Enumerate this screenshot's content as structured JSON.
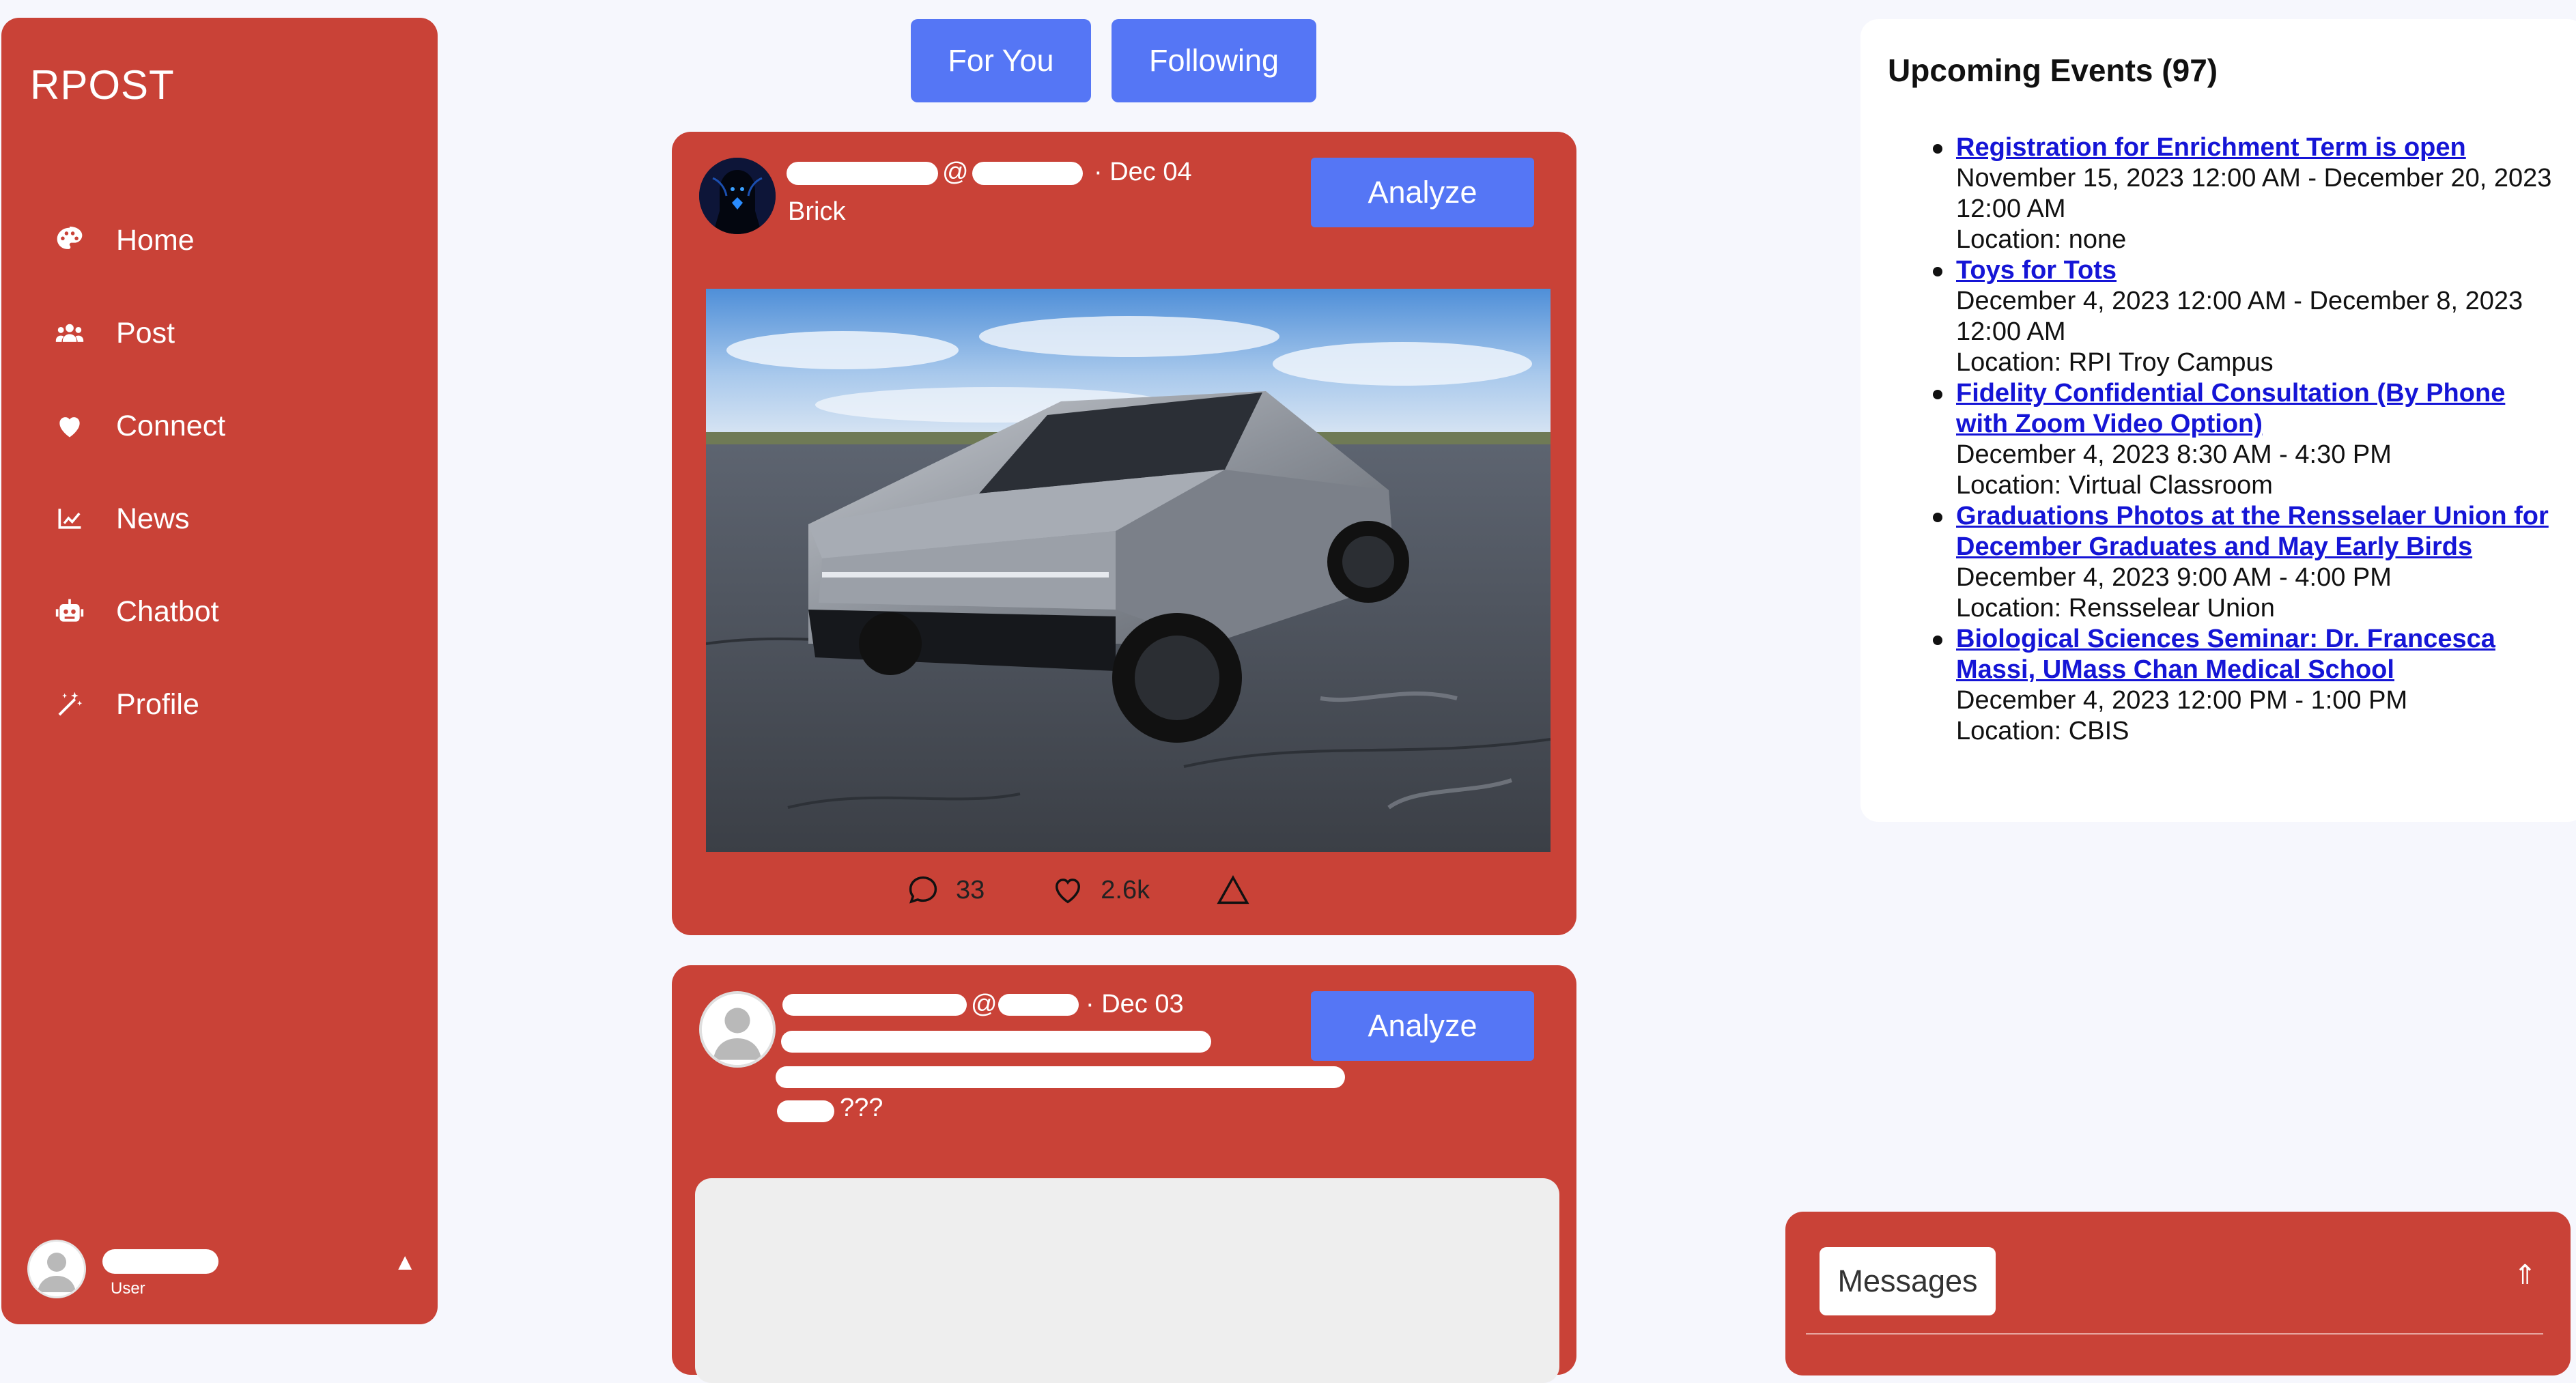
{
  "app": {
    "brand": "RPOST"
  },
  "sidebar": {
    "items": [
      {
        "label": "Home",
        "icon": "palette-icon"
      },
      {
        "label": "Post",
        "icon": "users-icon"
      },
      {
        "label": "Connect",
        "icon": "heart-icon"
      },
      {
        "label": "News",
        "icon": "chart-line-icon"
      },
      {
        "label": "Chatbot",
        "icon": "robot-icon"
      },
      {
        "label": "Profile",
        "icon": "magic-wand-icon"
      }
    ],
    "user": {
      "role": "User",
      "menu_caret": "▲"
    }
  },
  "feed": {
    "tabs": [
      "For You",
      "Following"
    ],
    "posts": [
      {
        "handle_prefix": "@",
        "date": "· Dec 04",
        "text": "Brick",
        "analyze_label": "Analyze",
        "comments": "33",
        "likes": "2.6k"
      },
      {
        "handle_prefix": "@",
        "date": "· Dec 03",
        "text_tail": "???",
        "analyze_label": "Analyze"
      }
    ]
  },
  "events": {
    "title": "Upcoming Events (97)",
    "items": [
      {
        "title": "Registration for Enrichment Term is open",
        "time": "November 15, 2023 12:00 AM - December 20, 2023 12:00 AM",
        "location": "Location: none"
      },
      {
        "title": "Toys for Tots",
        "time": "December 4, 2023 12:00 AM - December 8, 2023 12:00 AM",
        "location": "Location: RPI Troy Campus"
      },
      {
        "title": "Fidelity Confidential Consultation (By Phone with Zoom Video Option)",
        "time": "December 4, 2023 8:30 AM - 4:30 PM",
        "location": "Location: Virtual Classroom"
      },
      {
        "title": "Graduations Photos at the Rensselaer Union for December Graduates and May Early Birds",
        "time": "December 4, 2023 9:00 AM - 4:00 PM",
        "location": "Location: Rensselear Union"
      },
      {
        "title": "Biological Sciences Seminar: Dr. Francesca Massi, UMass Chan Medical School",
        "time": "December 4, 2023 12:00 PM - 1:00 PM",
        "location": "Location: CBIS"
      }
    ]
  },
  "messages": {
    "label": "Messages",
    "expand": "⇑"
  },
  "colors": {
    "accent_red": "#c94237",
    "button_blue": "#5576f5",
    "link_blue": "#1515d6",
    "background": "#f6f7fd"
  }
}
